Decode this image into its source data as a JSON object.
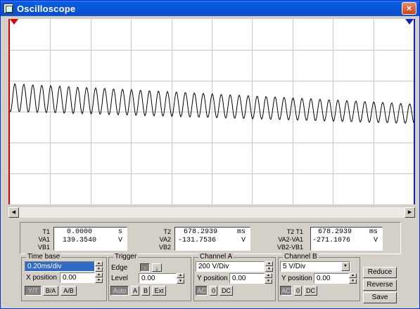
{
  "window": {
    "title": "Oscilloscope",
    "close_label": "×"
  },
  "markers": {
    "t1": "1",
    "t2": "2"
  },
  "scope": {
    "background": "#ffffff",
    "grid_color": "#c8c8c8",
    "trace_color": "#000000",
    "cursor1_color": "#e00000",
    "cursor2_color": "#1020c0"
  },
  "readout": {
    "g1": {
      "labels": [
        "T1",
        "VA1",
        "VB1"
      ],
      "value1": "0.0000",
      "unit1": "s",
      "value2": "139.3540",
      "unit2": "V"
    },
    "g2": {
      "labels": [
        "T2",
        "VA2",
        "VB2"
      ],
      "value1": "678.2939",
      "unit1": "ms",
      "value2": "-131.7536",
      "unit2": "V"
    },
    "g3": {
      "labels": [
        "T2 T1",
        "VA2-VA1",
        "VB2-VB1"
      ],
      "value1": "678.2939",
      "unit1": "ms",
      "value2": "-271.1076",
      "unit2": "V"
    }
  },
  "timebase": {
    "title": "Time base",
    "scale": "0.20ms/div",
    "xpos_label": "X position",
    "xpos_value": "0.00",
    "modes": [
      "Y/T",
      "B/A",
      "A/B"
    ]
  },
  "trigger": {
    "title": "Trigger",
    "edge_label": "Edge",
    "level_label": "Level",
    "level_value": "0.00",
    "buttons": [
      "Auto",
      "A",
      "B",
      "Ext"
    ]
  },
  "channel_a": {
    "title": "Channel A",
    "scale": "200 V/Div",
    "ypos_label": "Y position",
    "ypos_value": "0.00",
    "coupling": [
      "AC",
      "0",
      "DC"
    ]
  },
  "channel_b": {
    "title": "Channel B",
    "scale": "5 V/Div",
    "ypos_label": "Y position",
    "ypos_value": "0.00",
    "coupling": [
      "AC",
      "0",
      "DC"
    ]
  },
  "actions": {
    "reduce": "Reduce",
    "reverse": "Reverse",
    "save": "Save"
  }
}
